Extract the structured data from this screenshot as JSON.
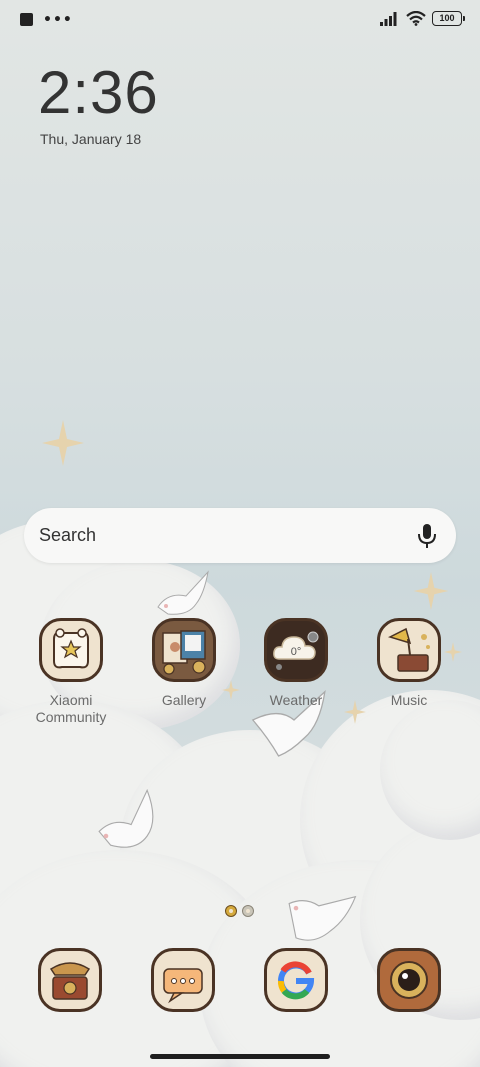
{
  "status_bar": {
    "battery": "100",
    "overflow_dots": "•••"
  },
  "lockclock": {
    "time": "2:36",
    "date": "Thu, January 18"
  },
  "search": {
    "placeholder": "Search"
  },
  "apps": [
    {
      "label": "Xiaomi Community",
      "icon": "xiaomi-community-icon"
    },
    {
      "label": "Gallery",
      "icon": "gallery-icon"
    },
    {
      "label": "Weather",
      "icon": "weather-icon",
      "temp": "0°"
    },
    {
      "label": "Music",
      "icon": "music-icon"
    }
  ],
  "dock": [
    {
      "icon": "phone-icon"
    },
    {
      "icon": "messages-icon"
    },
    {
      "icon": "google-icon"
    },
    {
      "icon": "camera-icon"
    }
  ],
  "colors": {
    "icon_border": "#4a3324",
    "icon_fill": "#efe3cf",
    "accent_gold": "#d9b25c"
  }
}
